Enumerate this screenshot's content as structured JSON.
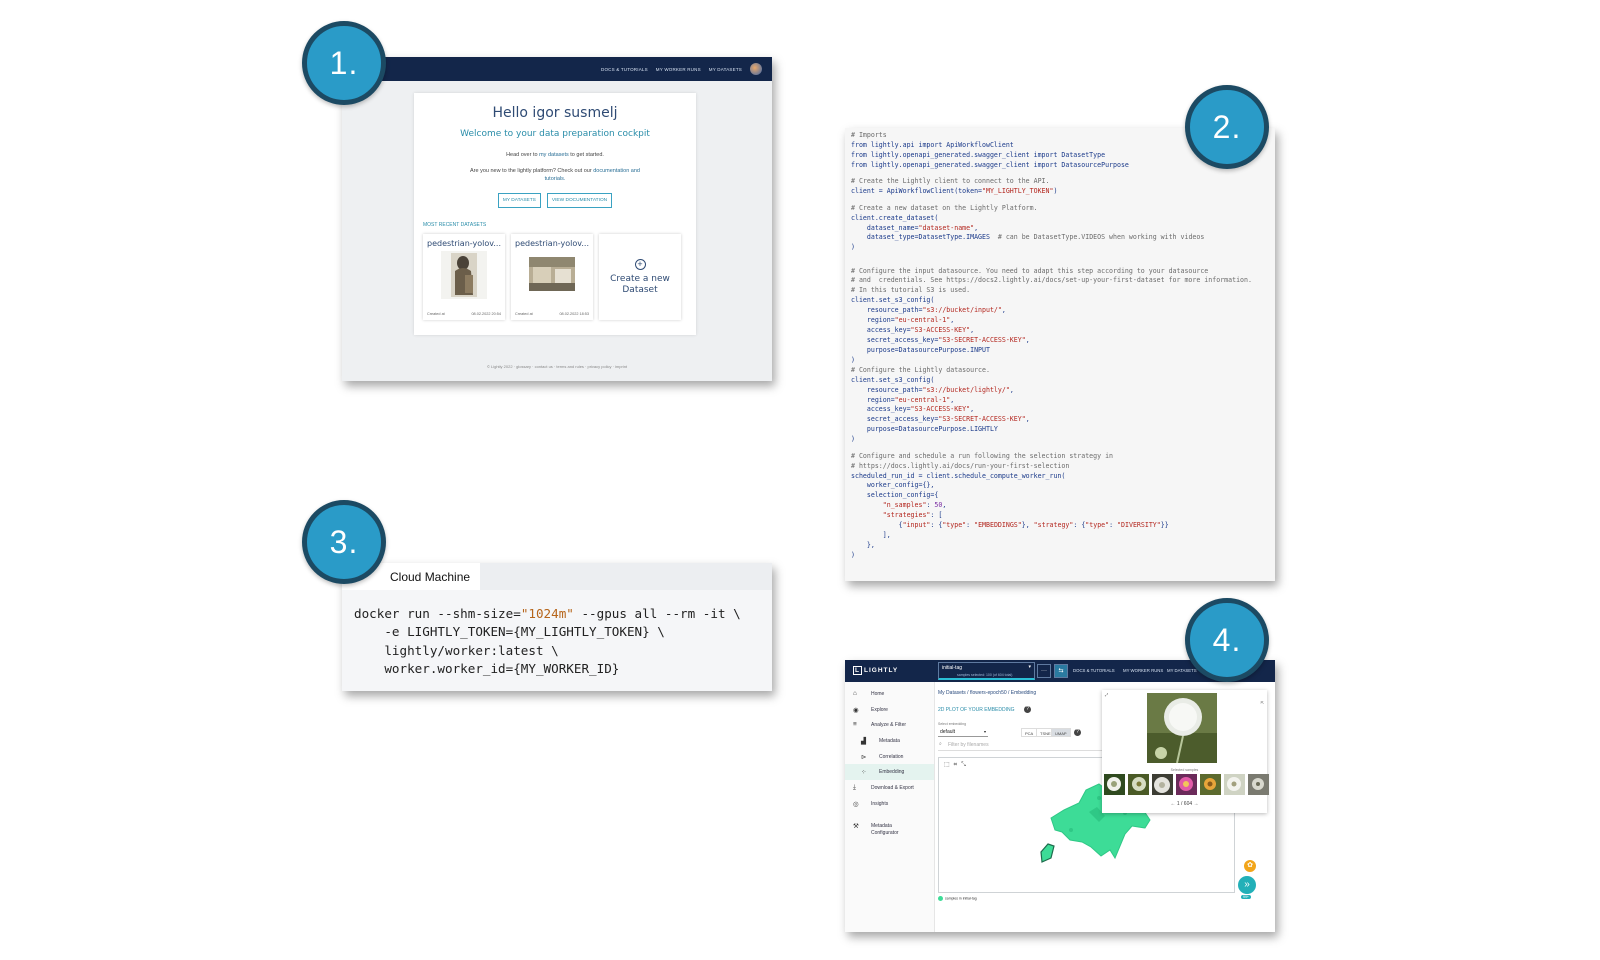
{
  "steps": [
    {
      "number": "1."
    },
    {
      "number": "2."
    },
    {
      "number": "3."
    },
    {
      "number": "4."
    }
  ],
  "colors": {
    "badge": "#2a9bc8",
    "badge_border": "#1c4a63",
    "navy": "#13264a",
    "teal": "#2a8da9",
    "embedding": "#3ddc97"
  },
  "panel1": {
    "nav": [
      "DOCS & TUTORIALS",
      "MY WORKER RUNS",
      "MY DATASETS"
    ],
    "hello": "Hello igor susmelj",
    "welcome": "Welcome to your data preparation cockpit",
    "head_over_pre": "Head over to ",
    "head_over_link": "my datasets",
    "head_over_post": " to get started.",
    "new_pre": "Are you new to the lightly platform? Check out our ",
    "new_link": "documentation and",
    "new_line2": "tutorials.",
    "btn_datasets": "MY DATASETS",
    "btn_docs": "VIEW DOCUMENTATION",
    "recent_label": "MOST RECENT DATASETS",
    "datasets": [
      {
        "name": "pedestrian-yolov...",
        "owner": "Created at",
        "date": "08.02.2022 20:54"
      },
      {
        "name": "pedestrian-yolov...",
        "owner": "Created at",
        "date": "08.02.2022 18:53"
      }
    ],
    "create_new": "Create a new Dataset",
    "footer": "© Lightly 2022  ·  glossary  ·  contact us  ·  terms and rules  ·  privacy policy  ·  imprint"
  },
  "panel2": {
    "code_lines": [
      [
        {
          "c": "c",
          "t": "# Imports"
        }
      ],
      [
        {
          "c": "k",
          "t": "from lightly.api import ApiWorkflowClient"
        }
      ],
      [
        {
          "c": "k",
          "t": "from lightly.openapi_generated.swagger_client import DatasetType"
        }
      ],
      [
        {
          "c": "k",
          "t": "from lightly.openapi_generated.swagger_client import DatasourcePurpose"
        }
      ],
      [
        {
          "c": "t",
          "t": ""
        }
      ],
      [
        {
          "c": "c",
          "t": "# Create the Lightly client to connect to the API."
        }
      ],
      [
        {
          "c": "k",
          "t": "client = ApiWorkflowClient(token="
        },
        {
          "c": "s",
          "t": "\"MY_LIGHTLY_TOKEN\""
        },
        {
          "c": "k",
          "t": ")"
        }
      ],
      [
        {
          "c": "t",
          "t": ""
        }
      ],
      [
        {
          "c": "c",
          "t": "# Create a new dataset on the Lightly Platform."
        }
      ],
      [
        {
          "c": "k",
          "t": "client.create_dataset("
        }
      ],
      [
        {
          "c": "k",
          "t": "    dataset_name="
        },
        {
          "c": "s",
          "t": "\"dataset-name\""
        },
        {
          "c": "k",
          "t": ","
        }
      ],
      [
        {
          "c": "k",
          "t": "    dataset_type=DatasetType.IMAGES  "
        },
        {
          "c": "c",
          "t": "# can be DatasetType.VIDEOS when working with videos"
        }
      ],
      [
        {
          "c": "k",
          "t": ")"
        }
      ],
      [
        {
          "c": "t",
          "t": ""
        }
      ],
      [
        {
          "c": "t",
          "t": ""
        }
      ],
      [
        {
          "c": "c",
          "t": "# Configure the input datasource. You need to adapt this step according to your datasource"
        }
      ],
      [
        {
          "c": "c",
          "t": "# and  credentials. See https://docs2.lightly.ai/docs/set-up-your-first-dataset for more information."
        }
      ],
      [
        {
          "c": "c",
          "t": "# In this tutorial S3 is used."
        }
      ],
      [
        {
          "c": "k",
          "t": "client.set_s3_config("
        }
      ],
      [
        {
          "c": "k",
          "t": "    resource_path="
        },
        {
          "c": "s",
          "t": "\"s3://bucket/input/\""
        },
        {
          "c": "k",
          "t": ","
        }
      ],
      [
        {
          "c": "k",
          "t": "    region="
        },
        {
          "c": "s",
          "t": "\"eu-central-1\""
        },
        {
          "c": "k",
          "t": ","
        }
      ],
      [
        {
          "c": "k",
          "t": "    access_key="
        },
        {
          "c": "s",
          "t": "\"S3-ACCESS-KEY\""
        },
        {
          "c": "k",
          "t": ","
        }
      ],
      [
        {
          "c": "k",
          "t": "    secret_access_key="
        },
        {
          "c": "s",
          "t": "\"S3-SECRET-ACCESS-KEY\""
        },
        {
          "c": "k",
          "t": ","
        }
      ],
      [
        {
          "c": "k",
          "t": "    purpose=DatasourcePurpose.INPUT"
        }
      ],
      [
        {
          "c": "k",
          "t": ")"
        }
      ],
      [
        {
          "c": "c",
          "t": "# Configure the Lightly datasource."
        }
      ],
      [
        {
          "c": "k",
          "t": "client.set_s3_config("
        }
      ],
      [
        {
          "c": "k",
          "t": "    resource_path="
        },
        {
          "c": "s",
          "t": "\"s3://bucket/lightly/\""
        },
        {
          "c": "k",
          "t": ","
        }
      ],
      [
        {
          "c": "k",
          "t": "    region="
        },
        {
          "c": "s",
          "t": "\"eu-central-1\""
        },
        {
          "c": "k",
          "t": ","
        }
      ],
      [
        {
          "c": "k",
          "t": "    access_key="
        },
        {
          "c": "s",
          "t": "\"S3-ACCESS-KEY\""
        },
        {
          "c": "k",
          "t": ","
        }
      ],
      [
        {
          "c": "k",
          "t": "    secret_access_key="
        },
        {
          "c": "s",
          "t": "\"S3-SECRET-ACCESS-KEY\""
        },
        {
          "c": "k",
          "t": ","
        }
      ],
      [
        {
          "c": "k",
          "t": "    purpose=DatasourcePurpose.LIGHTLY"
        }
      ],
      [
        {
          "c": "k",
          "t": ")"
        }
      ],
      [
        {
          "c": "t",
          "t": ""
        }
      ],
      [
        {
          "c": "c",
          "t": "# Configure and schedule a run following the selection strategy in"
        }
      ],
      [
        {
          "c": "c",
          "t": "# https://docs.lightly.ai/docs/run-your-first-selection"
        }
      ],
      [
        {
          "c": "k",
          "t": "scheduled_run_id = client.schedule_compute_worker_run("
        }
      ],
      [
        {
          "c": "k",
          "t": "    worker_config={},"
        }
      ],
      [
        {
          "c": "k",
          "t": "    selection_config={"
        }
      ],
      [
        {
          "c": "s",
          "t": "        \"n_samples\""
        },
        {
          "c": "k",
          "t": ": "
        },
        {
          "c": "n",
          "t": "50"
        },
        {
          "c": "k",
          "t": ","
        }
      ],
      [
        {
          "c": "s",
          "t": "        \"strategies\""
        },
        {
          "c": "k",
          "t": ": ["
        }
      ],
      [
        {
          "c": "k",
          "t": "            {"
        },
        {
          "c": "s",
          "t": "\"input\""
        },
        {
          "c": "k",
          "t": ": {"
        },
        {
          "c": "s",
          "t": "\"type\""
        },
        {
          "c": "k",
          "t": ": "
        },
        {
          "c": "s",
          "t": "\"EMBEDDINGS\""
        },
        {
          "c": "k",
          "t": "}, "
        },
        {
          "c": "s",
          "t": "\"strategy\""
        },
        {
          "c": "k",
          "t": ": {"
        },
        {
          "c": "s",
          "t": "\"type\""
        },
        {
          "c": "k",
          "t": ": "
        },
        {
          "c": "s",
          "t": "\"DIVERSITY\""
        },
        {
          "c": "k",
          "t": "}}"
        }
      ],
      [
        {
          "c": "k",
          "t": "        ],"
        }
      ],
      [
        {
          "c": "k",
          "t": "    },"
        }
      ],
      [
        {
          "c": "k",
          "t": ")"
        }
      ]
    ]
  },
  "panel3": {
    "tab": "Cloud Machine",
    "code_lines": [
      [
        {
          "c": "t",
          "t": "docker run --shm-size="
        },
        {
          "c": "s",
          "t": "\"1024m\""
        },
        {
          "c": "t",
          "t": " --gpus all --rm -it \\"
        }
      ],
      [
        {
          "c": "t",
          "t": "    -e LIGHTLY_TOKEN={MY_LIGHTLY_TOKEN} \\"
        }
      ],
      [
        {
          "c": "t",
          "t": "    lightly/worker:latest \\"
        }
      ],
      [
        {
          "c": "t",
          "t": "    worker.worker_id={MY_WORKER_ID}"
        }
      ]
    ]
  },
  "panel4": {
    "logo": "LIGHTLY",
    "tag_value": "initial-tag",
    "tag_sub": "samples selected: 100 (of 604 total)",
    "nav": [
      "DOCS & TUTORIALS",
      "MY WORKER RUNS",
      "MY DATASETS"
    ],
    "sidebar": [
      {
        "label": "Home",
        "icon": "home-icon",
        "glyph": "⌂",
        "sub": false
      },
      {
        "label": "Explore",
        "icon": "compass-icon",
        "glyph": "◉",
        "sub": false
      },
      {
        "label": "Analyze & Filter",
        "icon": "filter-icon",
        "glyph": "≡",
        "sub": false
      },
      {
        "label": "Metadata",
        "icon": "bar-chart-icon",
        "glyph": "▟",
        "sub": true
      },
      {
        "label": "Correlation",
        "icon": "correlation-icon",
        "glyph": "⊳",
        "sub": true
      },
      {
        "label": "Embedding",
        "icon": "scatter-icon",
        "glyph": "⁘",
        "sub": true,
        "active": true
      },
      {
        "label": "Download & Export",
        "icon": "download-icon",
        "glyph": "⤓",
        "sub": false
      },
      {
        "label": "Insights",
        "icon": "eye-icon",
        "glyph": "◎",
        "sub": false
      }
    ],
    "metadata_config": "Metadata Configurator",
    "breadcrumb": "My Datasets  /  flowers-epoch50  /  Embedding",
    "title": "2D PLOT OF YOUR EMBEDDING",
    "select_label": "Select embedding",
    "select_value": "default",
    "algorithms": [
      {
        "name": "PCA",
        "selected": false
      },
      {
        "name": "TSNE",
        "selected": false
      },
      {
        "name": "UMAP",
        "selected": true
      }
    ],
    "filter_placeholder": "Filter by filenames",
    "legend": "samples in initial-tag",
    "popup_label": "Selected samples",
    "popup_nav": "←   1 / 604   →",
    "fab_top": "✿",
    "fab_bottom": "»",
    "fab_small": "99+"
  }
}
